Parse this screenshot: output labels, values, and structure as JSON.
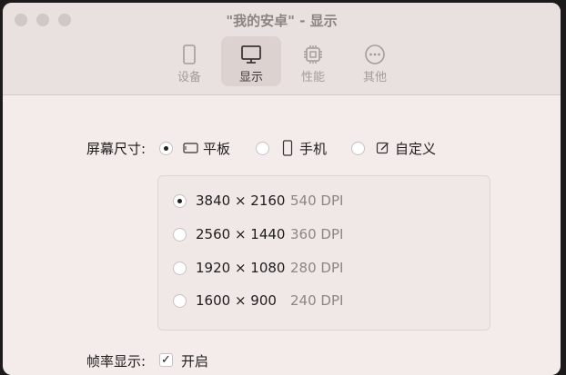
{
  "window": {
    "title": "\"我的安卓\" - 显示"
  },
  "tabs": [
    {
      "label": "设备",
      "icon": "tablet-device-icon",
      "active": false
    },
    {
      "label": "显示",
      "icon": "monitor-icon",
      "active": true
    },
    {
      "label": "性能",
      "icon": "cpu-chip-icon",
      "active": false
    },
    {
      "label": "其他",
      "icon": "more-dots-icon",
      "active": false
    }
  ],
  "screen_size": {
    "label": "屏幕尺寸:",
    "options": [
      {
        "label": "平板",
        "icon": "tablet-landscape-icon",
        "selected": true
      },
      {
        "label": "手机",
        "icon": "phone-icon",
        "selected": false
      },
      {
        "label": "自定义",
        "icon": "edit-icon",
        "selected": false
      }
    ]
  },
  "resolutions": [
    {
      "value": "3840 × 2160",
      "dpi": "540 DPI",
      "selected": true
    },
    {
      "value": "2560 × 1440",
      "dpi": "360 DPI",
      "selected": false
    },
    {
      "value": "1920 × 1080",
      "dpi": "280 DPI",
      "selected": false
    },
    {
      "value": "1600 × 900",
      "dpi": "240 DPI",
      "selected": false
    }
  ],
  "frame_rate": {
    "label": "帧率显示:",
    "checkbox_label": "开启",
    "checked": true
  }
}
